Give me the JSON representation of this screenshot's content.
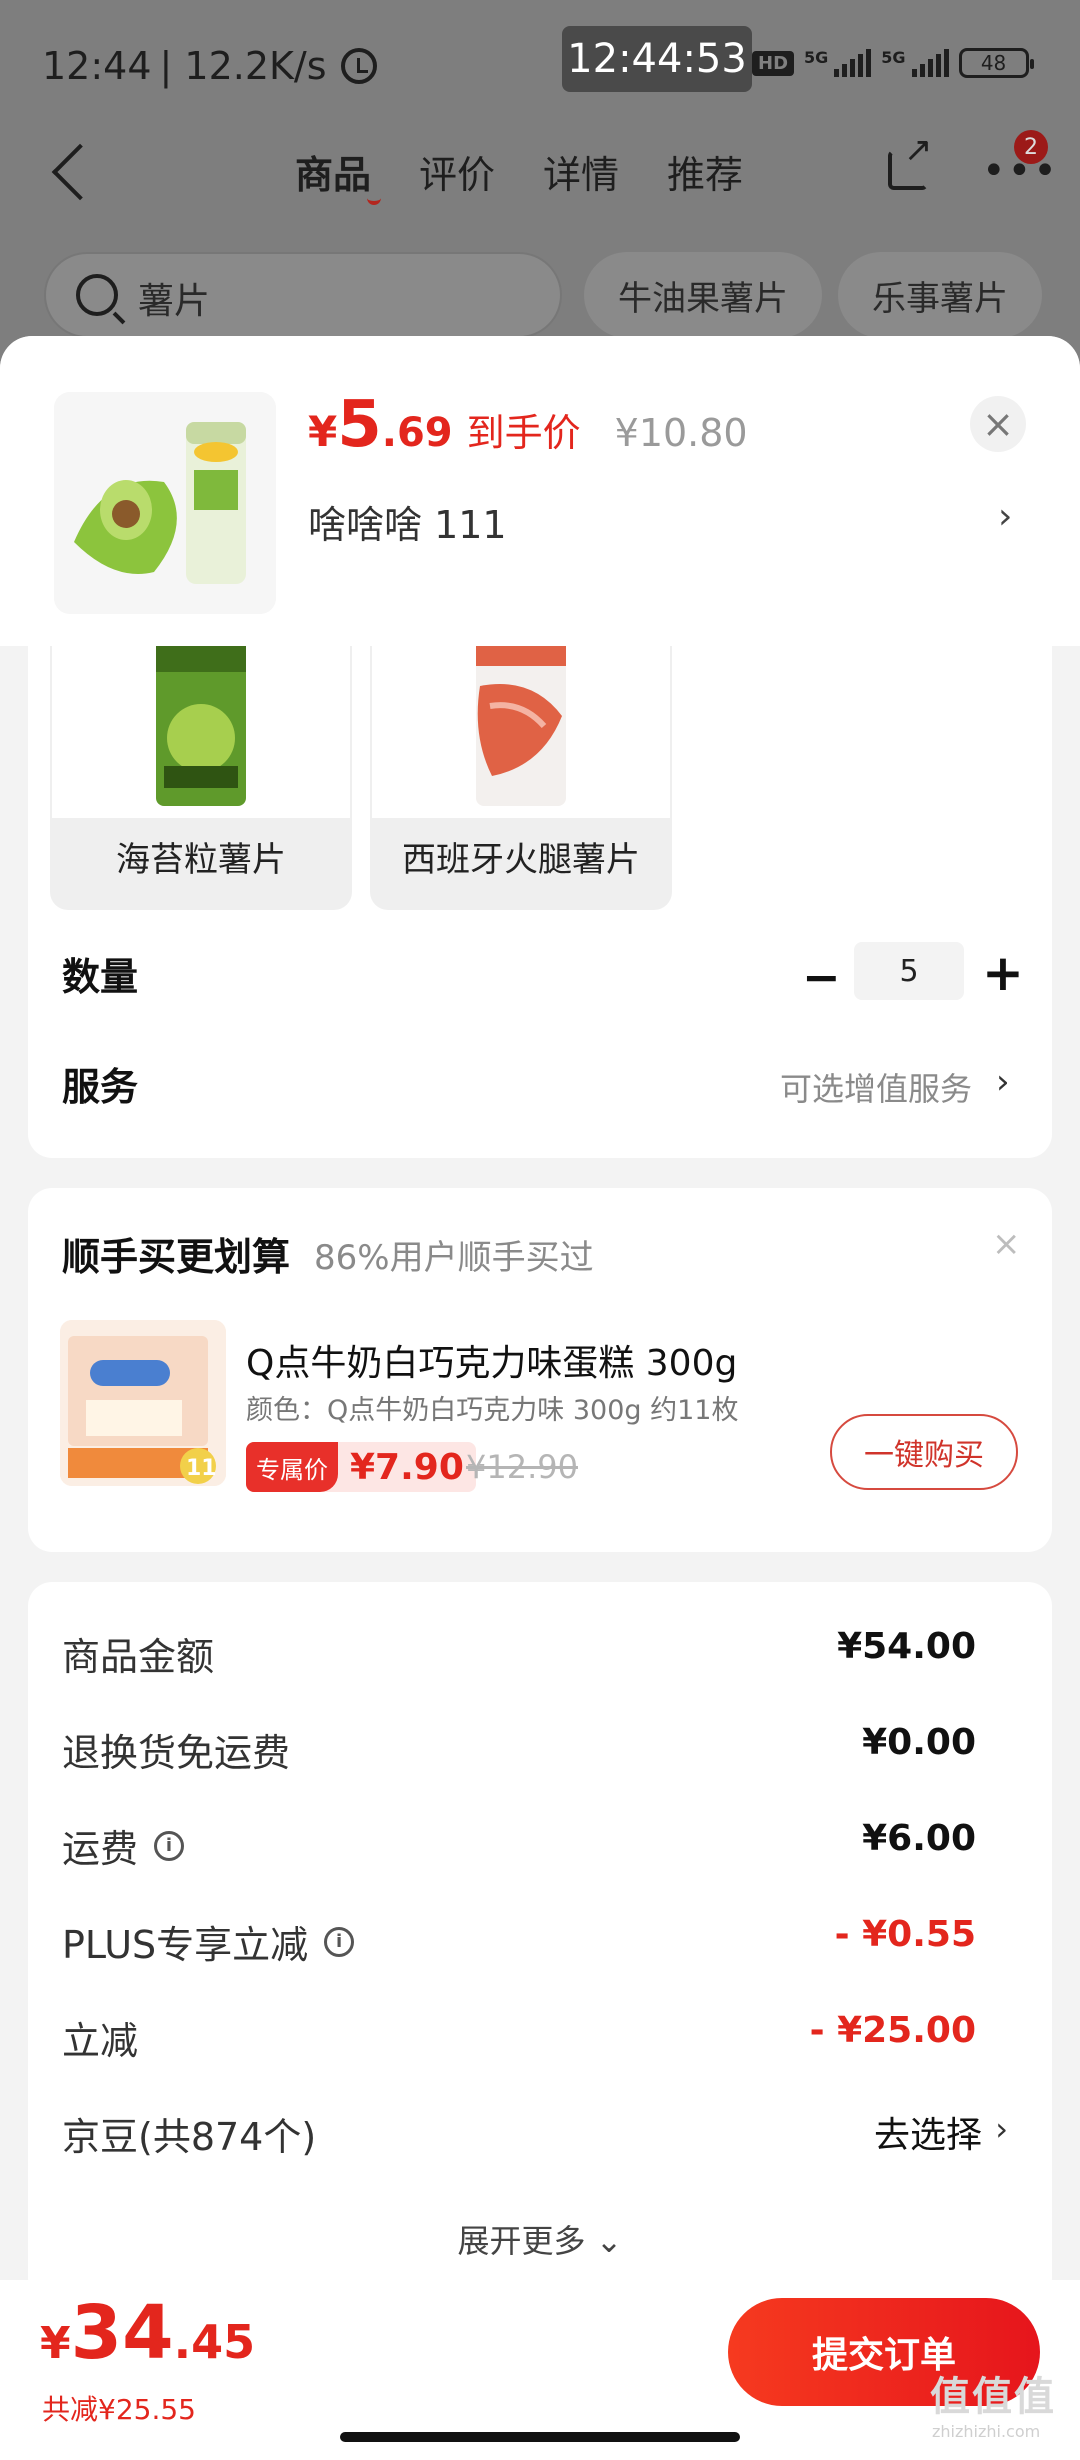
{
  "status_bar": {
    "time": "12:44",
    "speed": "| 12.2K/s",
    "overlay_clock": "12:44:53",
    "hd_label": "HD",
    "network_1": "5G",
    "network_2": "5G",
    "battery": "48"
  },
  "nav": {
    "tabs": [
      {
        "label": "商品",
        "active": true
      },
      {
        "label": "评价",
        "active": false
      },
      {
        "label": "详情",
        "active": false
      },
      {
        "label": "推荐",
        "active": false
      }
    ],
    "more_badge": "2"
  },
  "search": {
    "query": "薯片",
    "chips": [
      "牛油果薯片",
      "乐事薯片"
    ]
  },
  "product": {
    "price_yen": "¥",
    "price_int": "5",
    "price_dec": ".69",
    "price_tag": "到手价",
    "original_price": "¥10.80",
    "variant": "啥啥啥  111",
    "close": "×",
    "arrow": "›"
  },
  "flavors": [
    {
      "label": "海苔粒薯片",
      "color": "#5f9a2b"
    },
    {
      "label": "西班牙火腿薯片",
      "color": "#e06245"
    }
  ],
  "quantity": {
    "label": "数量",
    "minus": "−",
    "value": "5",
    "plus": "+"
  },
  "service": {
    "label": "服务",
    "value": "可选增值服务",
    "arrow": "›"
  },
  "bundle": {
    "title": "顺手买更划算",
    "subtitle": "86%用户顺手买过",
    "close": "×",
    "item_name": "Q点牛奶白巧克力味蛋糕 300g",
    "item_spec": "颜色：Q点牛奶白巧克力味 300g 约11枚",
    "exclusive_tag": "专属价",
    "exclusive_price": "¥7.90",
    "original_price": "¥12.90",
    "buy_button": "一键购买",
    "img_badge": "11"
  },
  "summary": {
    "rows": [
      {
        "label": "商品金额",
        "value": "¥54.00",
        "info": false,
        "style": "normal"
      },
      {
        "label": "退换货免运费",
        "value": "¥0.00",
        "info": false,
        "style": "normal"
      },
      {
        "label": "运费",
        "value": "¥6.00",
        "info": true,
        "style": "normal"
      },
      {
        "label": "PLUS专享立减",
        "value": "- ¥0.55",
        "info": true,
        "style": "red"
      },
      {
        "label": "立减",
        "value": "- ¥25.00",
        "info": false,
        "style": "red"
      },
      {
        "label": "京豆(共874个)",
        "value": "去选择",
        "info": false,
        "style": "link"
      }
    ],
    "info_glyph": "i",
    "arrow": "›",
    "expand": "展开更多 ⌄"
  },
  "bottom": {
    "total_yen": "¥",
    "total_int": "34",
    "total_dec": ".45",
    "saved": "共减¥25.55",
    "submit": "提交订单",
    "watermark": "值值值",
    "watermark_url": "zhizhizhi.com"
  },
  "colors": {
    "accent": "#e3261d",
    "dim_overlay": "#7e7e7e"
  }
}
